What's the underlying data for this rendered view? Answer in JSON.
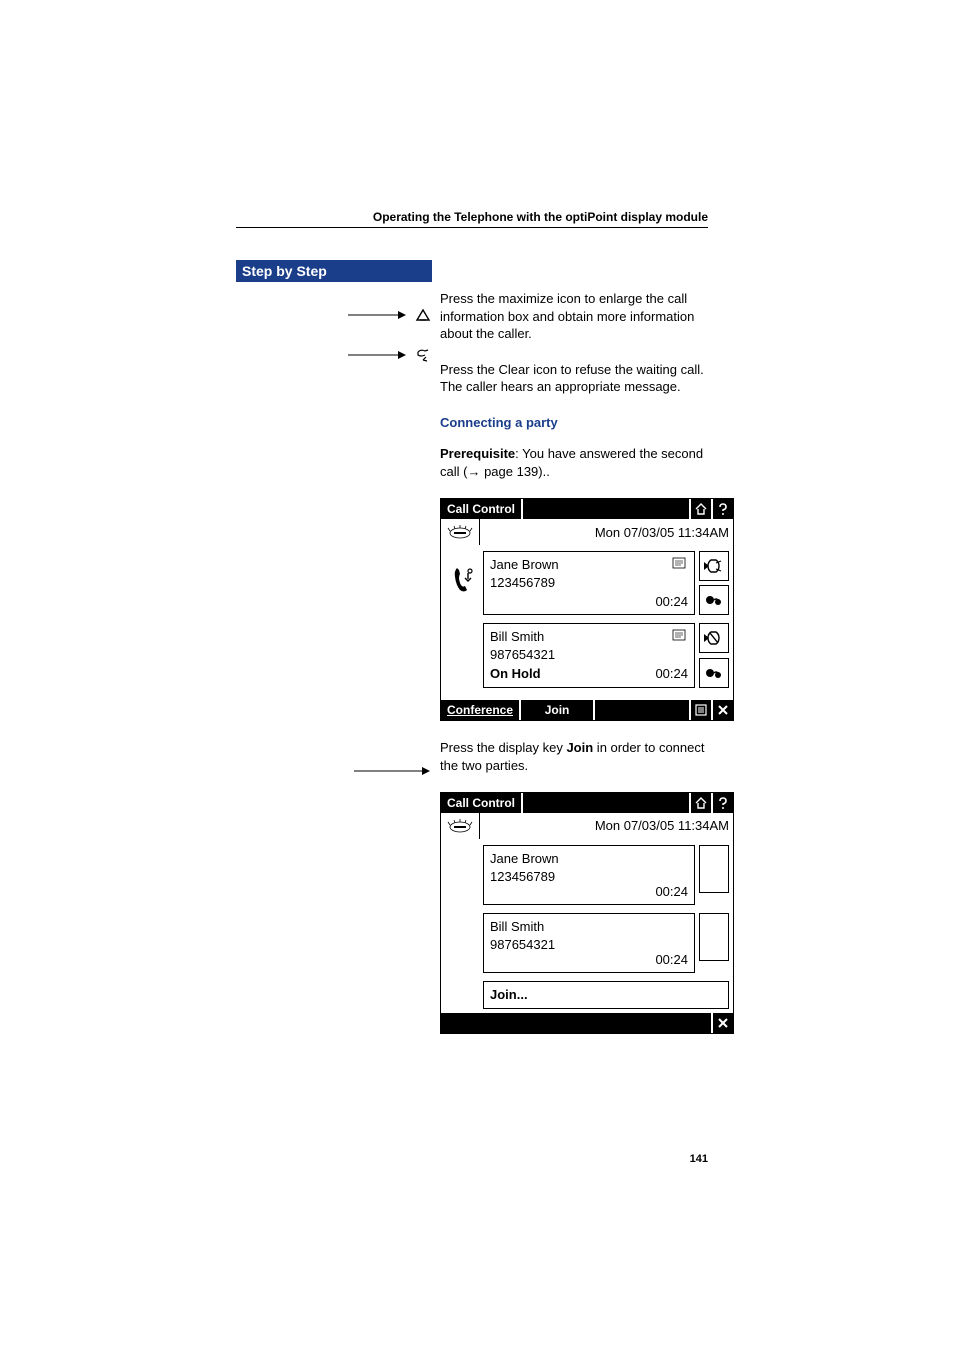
{
  "header": {
    "section_title": "Operating the Telephone with the optiPoint display module"
  },
  "sidebar": {
    "step_label": "Step by Step",
    "icons": [
      "maximize-icon",
      "clear-icon",
      "arrow-icon"
    ]
  },
  "content": {
    "para1": "Press the maximize icon to enlarge the call information box and obtain more information about the caller.",
    "para2": "Press the Clear icon to refuse the waiting call. The caller hears an appropriate message.",
    "subheading": "Connecting a party",
    "prereq_label": "Prerequisite",
    "prereq_text": ": You have answered the second call (",
    "prereq_arrow": "→",
    "prereq_page": " page 139)..",
    "para3_a": "Press the display key ",
    "para3_bold": "Join",
    "para3_b": " in order to connect the two parties."
  },
  "phone1": {
    "title": "Call Control",
    "top_icons": [
      "home-icon",
      "help-icon"
    ],
    "datetime": "Mon 07/03/05 11:34AM",
    "left_glyph": "alert-icon",
    "strip_icon": "handset-transfer-icon",
    "call_a": {
      "name": "Jane Brown",
      "number": "123456789",
      "duration": "00:24",
      "note_icon": "notes-icon",
      "side_icons": [
        "speaker-icon",
        "record-icon"
      ]
    },
    "call_b": {
      "name": "Bill Smith",
      "number": "987654321",
      "status": "On Hold",
      "duration": "00:24",
      "note_icon": "notes-icon",
      "side_icons": [
        "speaker-mute-icon",
        "record-icon"
      ]
    },
    "bottom": {
      "btn1": "Conference",
      "btn2": "Join",
      "icons": [
        "list-icon",
        "close-icon"
      ]
    }
  },
  "phone2": {
    "title": "Call Control",
    "top_icons": [
      "home-icon",
      "help-icon"
    ],
    "datetime": "Mon 07/03/05 11:34AM",
    "left_glyph": "alert-icon",
    "call_a": {
      "name": "Jane Brown",
      "number": "123456789",
      "duration": "00:24"
    },
    "call_b": {
      "name": "Bill Smith",
      "number": "987654321",
      "duration": "00:24"
    },
    "join_label": "Join...",
    "bottom": {
      "icons": [
        "close-icon"
      ]
    }
  },
  "footer": {
    "page_number": "141"
  }
}
